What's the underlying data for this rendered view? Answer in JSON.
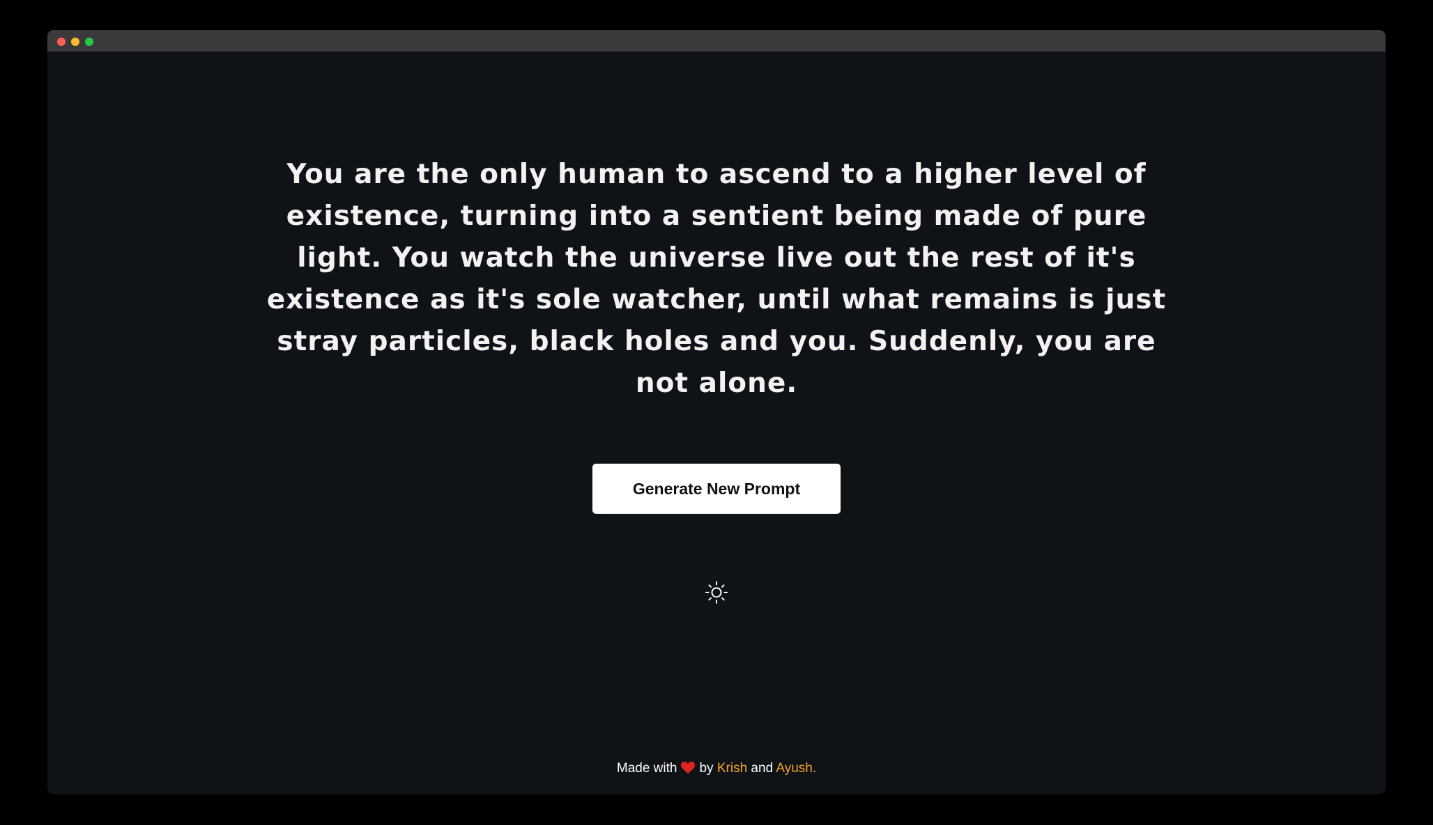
{
  "window": {
    "controls": {
      "close_color": "#ff5f57",
      "minimize_color": "#febc2e",
      "maximize_color": "#28c840"
    }
  },
  "prompt": {
    "text": "You are the only human to ascend to a higher level of existence, turning into a sentient being made of pure light. You watch the universe live out the rest of it's existence as it's sole watcher, until what remains is just stray particles, black holes and you. Suddenly, you are not alone."
  },
  "button": {
    "label": "Generate New Prompt"
  },
  "theme_toggle": {
    "icon": "sun-icon"
  },
  "footer": {
    "made_with": "Made with",
    "heart_icon": "heart-icon",
    "heart_color": "#e02424",
    "by": "by",
    "author1": "Krish",
    "and": "and",
    "author2": "Ayush.",
    "link_color": "#f5a623"
  }
}
